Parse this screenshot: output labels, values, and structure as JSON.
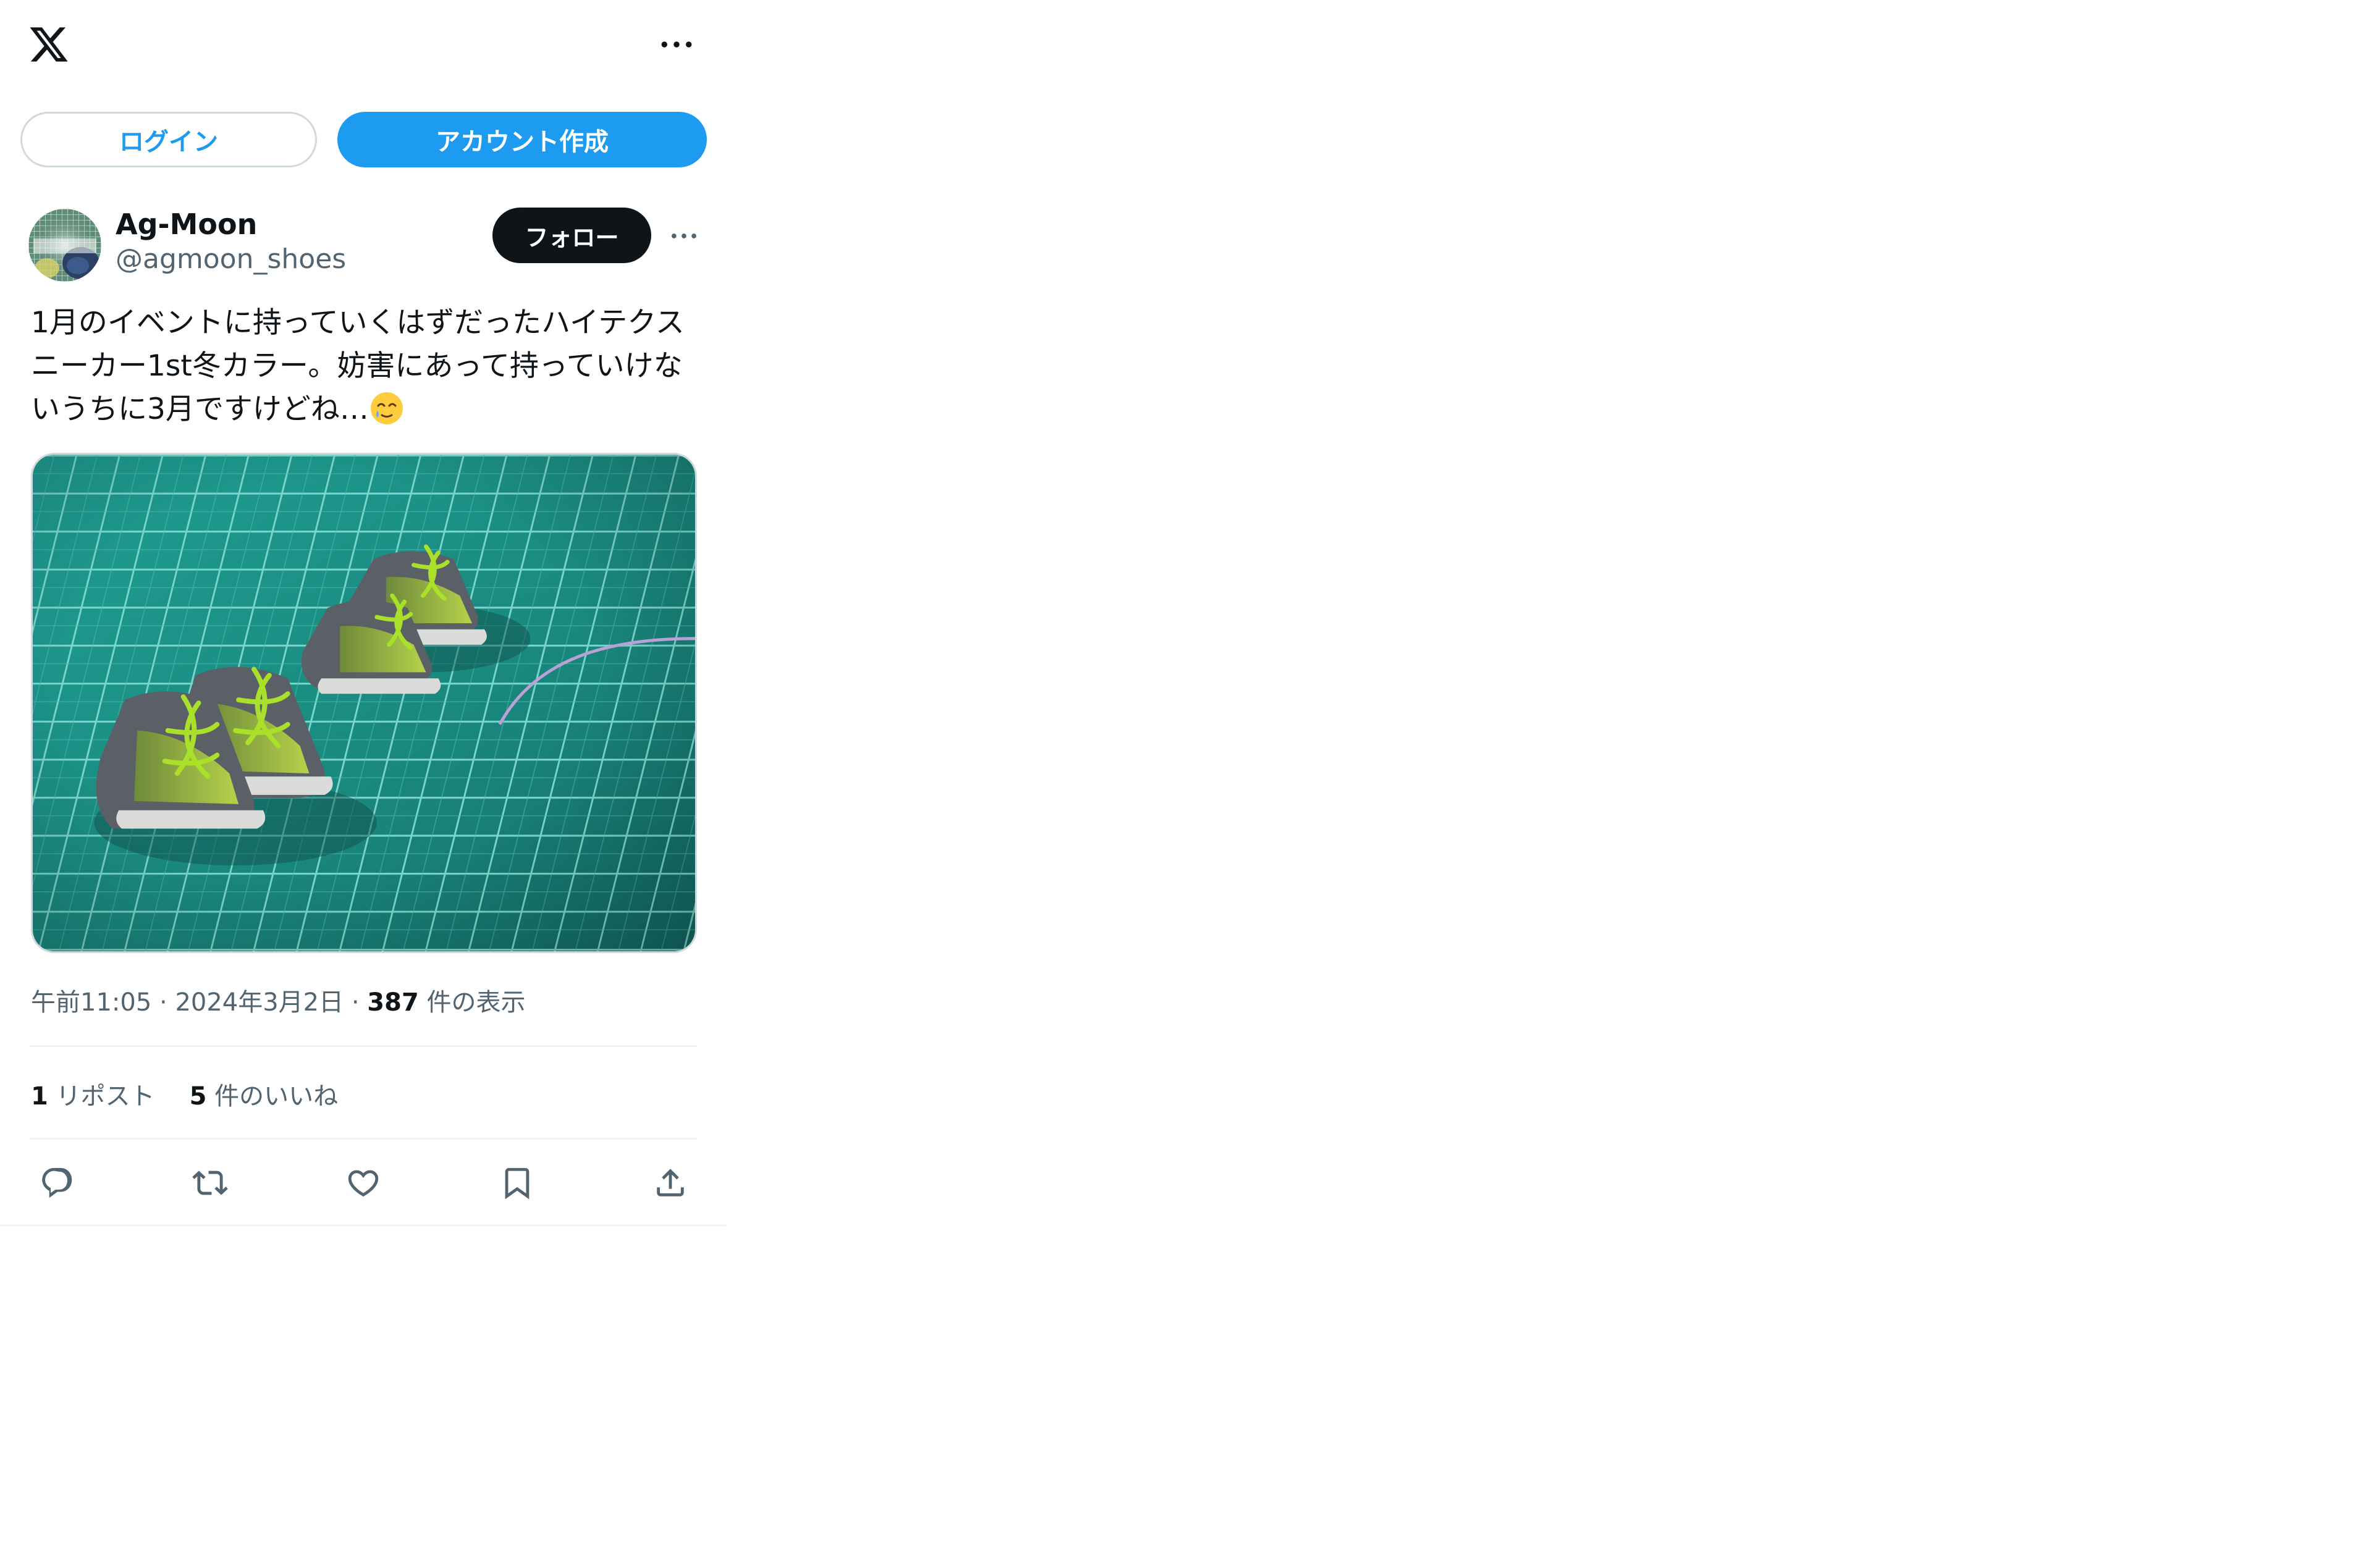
{
  "header": {
    "logo_icon": "x-logo-icon",
    "more_icon": "more-horizontal-icon"
  },
  "auth": {
    "login_label": "ログイン",
    "signup_label": "アカウント作成"
  },
  "author": {
    "name": "Ag-Moon",
    "handle": "@agmoon_shoes",
    "avatar_text": "Ag-Moon",
    "follow_label": "フォロー"
  },
  "tweet": {
    "text": "1月のイベントに持っていくはずだったハイテクスニーカー1st冬カラー。妨害にあって持っていけないうちに3月ですけどね…",
    "emoji": "face-holding-back-tears",
    "photo_alt": "green and grey miniature sneakers on a cutting mat"
  },
  "meta": {
    "time": "午前11:05",
    "date": "2024年3月2日",
    "views_count": "387",
    "views_label": "件の表示"
  },
  "stats": {
    "reposts_count": "1",
    "reposts_label": "リポスト",
    "likes_count": "5",
    "likes_label": "件のいいね"
  },
  "actions": {
    "reply_icon": "reply-icon",
    "repost_icon": "repost-icon",
    "like_icon": "like-icon",
    "bookmark_icon": "bookmark-icon",
    "share_icon": "share-icon"
  },
  "colors": {
    "brand_blue": "#1d9bf0",
    "text_primary": "#0f1419",
    "text_secondary": "#536471",
    "border": "#cfd9de",
    "divider": "#eff3f4"
  }
}
